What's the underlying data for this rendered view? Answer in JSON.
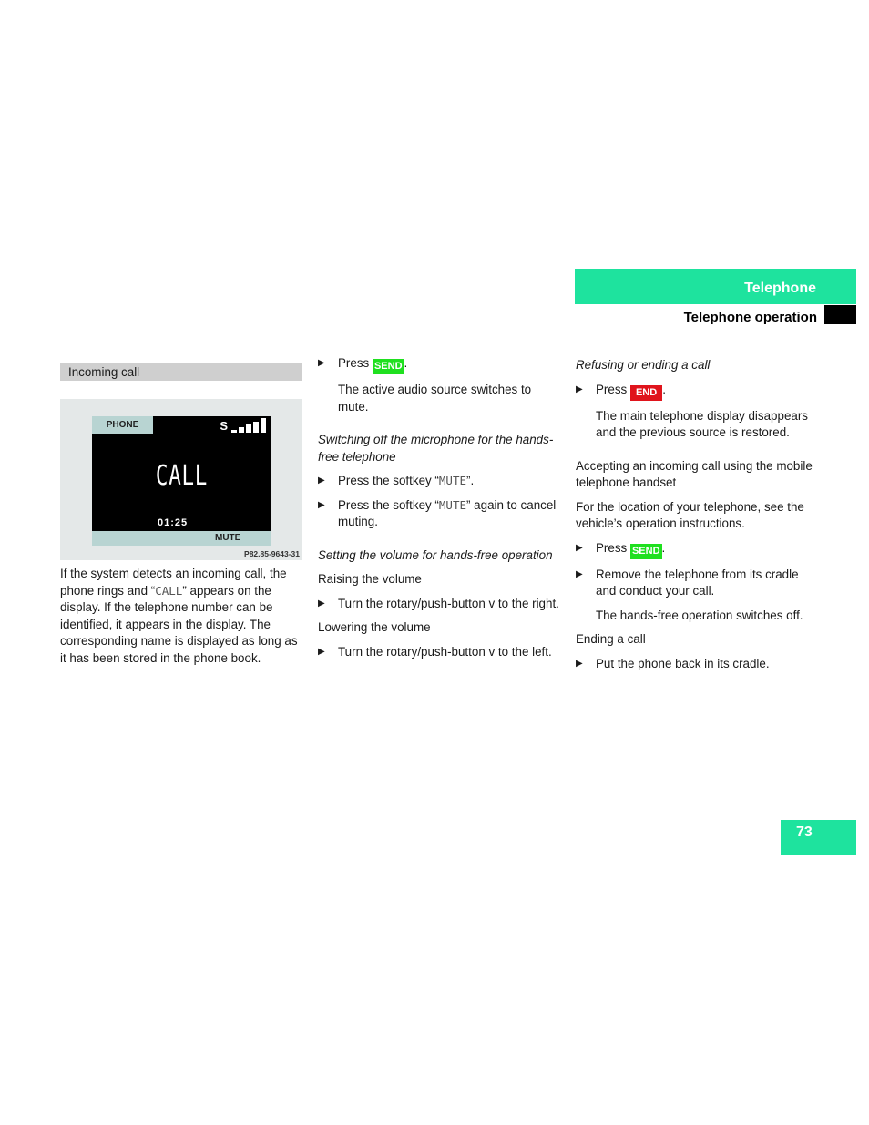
{
  "header": {
    "section_title": "Telephone",
    "subsection_title": "Telephone operation"
  },
  "colors": {
    "accent": "#1ee39e",
    "send_key": "#1fe01f",
    "end_key": "#e0141c"
  },
  "column1": {
    "caption": "Incoming call",
    "display": {
      "tab_label": "PHONE",
      "signal_label": "S",
      "signal_bars": 5,
      "main_text": "CALL",
      "timer": "01:25",
      "softkey": "MUTE"
    },
    "figure_code": "P82.85-9643-31",
    "paragraph": [
      "If the system detects an incoming call, the phone rings and “",
      "CALL",
      "” appears on the display. If the telephone number can be identified, it appears in the display. The corresponding name is displayed as long as it has been stored in the phone book."
    ]
  },
  "column2": {
    "step1": {
      "prefix": "Press ",
      "key": "SEND",
      "suffix": "."
    },
    "step1_result": "The active audio source switches to mute.",
    "mic_heading": "Switching off the microphone for the hands-free telephone",
    "mic_step1": {
      "prefix": "Press the softkey “",
      "key": "MUTE",
      "suffix": "”."
    },
    "mic_step2": {
      "prefix": "Press the softkey “",
      "key": "MUTE",
      "suffix": "” again to cancel muting."
    },
    "volume_heading": "Setting the volume for hands-free operation",
    "raise_label": "Raising the volume",
    "raise_step": "Turn the rotary/push-button v to the right.",
    "lower_label": "Lowering the volume",
    "lower_step": "Turn the rotary/push-button v to the left."
  },
  "column3": {
    "refuse_heading": "Refusing or ending a call",
    "refuse_step": {
      "prefix": "Press ",
      "key": "END",
      "suffix": "."
    },
    "refuse_result": "The main telephone display disappears and the previous source is restored.",
    "accept_heading": "Accepting an incoming call using the mobile telephone handset",
    "accept_intro": "For the location of your telephone, see the vehicle’s operation instructions.",
    "accept_step1": {
      "prefix": "Press ",
      "key": "SEND",
      "suffix": "."
    },
    "accept_step2": "Remove the telephone from its cradle and conduct your call.",
    "accept_result": "The hands-free operation switches off.",
    "ending_label": "Ending a call",
    "ending_step": "Put the phone back in its cradle."
  },
  "bullet_icon": "▶",
  "page_number": "73"
}
